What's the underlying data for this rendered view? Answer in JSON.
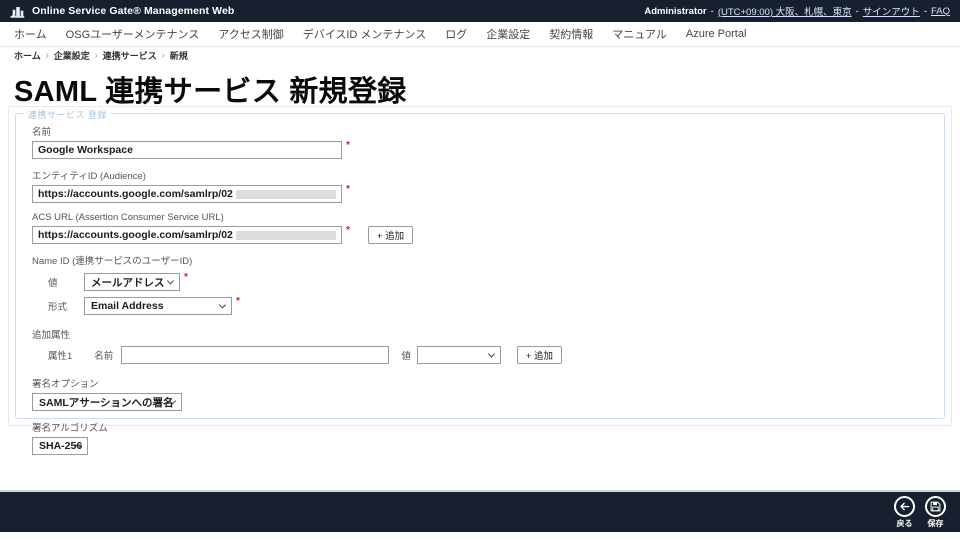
{
  "colors": {
    "header_bg": "#16202e",
    "required_red": "#cc2222",
    "fieldset_border": "#ccdcee",
    "legend_text": "#a9c2dd"
  },
  "header": {
    "app_title": "Online Service Gate® Management Web",
    "user_label": "Administrator",
    "separator": "-",
    "links": {
      "timezone": "(UTC+09:00) 大阪、札幌、東京",
      "signout": "サインアウト",
      "faq": "FAQ"
    }
  },
  "nav": {
    "items": [
      "ホーム",
      "OSGユーザーメンテナンス",
      "アクセス制御",
      "デバイスID メンテナンス",
      "ログ",
      "企業設定",
      "契約情報",
      "マニュアル",
      "Azure Portal"
    ]
  },
  "breadcrumb": {
    "separator": "›",
    "items": [
      "ホーム",
      "企業設定",
      "連携サービス",
      "新規"
    ]
  },
  "page": {
    "title": "SAML 連携サービス 新規登録"
  },
  "form": {
    "legend": "連携サービス 登録",
    "required_marker": "*",
    "name": {
      "label": "名前",
      "value": "Google Workspace"
    },
    "entity_id": {
      "label": "エンティティID (Audience)",
      "value": "https://accounts.google.com/samlrp/02"
    },
    "acs_url": {
      "label": "ACS URL (Assertion Consumer Service URL)",
      "value": "https://accounts.google.com/samlrp/02",
      "add_button": "+ 追加"
    },
    "name_id": {
      "section_label": "Name ID (連携サービスのユーザーID)",
      "value_label": "値",
      "value_selected": "メールアドレス",
      "format_label": "形式",
      "format_selected": "Email Address"
    },
    "additional_attributes": {
      "section_label": "追加属性",
      "row_label": "属性1",
      "name_label": "名前",
      "name_value": "",
      "value_label": "値",
      "value_selected": "",
      "add_button": "+ 追加"
    },
    "signing_option": {
      "label": "署名オプション",
      "selected": "SAMLアサーションへの署名"
    },
    "signing_algorithm": {
      "label": "署名アルゴリズム",
      "selected": "SHA-256"
    }
  },
  "footer": {
    "back_label": "戻る",
    "save_label": "保存"
  }
}
